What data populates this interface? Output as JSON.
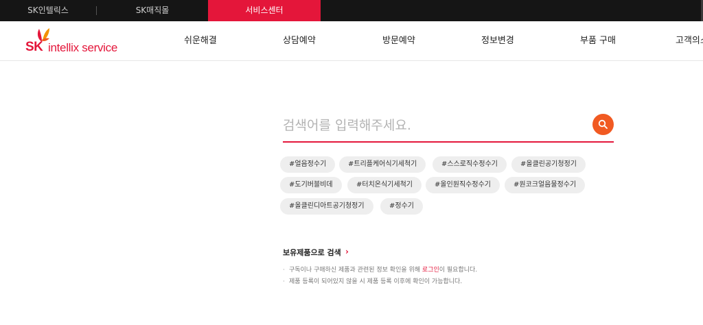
{
  "topbar": {
    "links": [
      "SK인텔릭스",
      "SK매직몰",
      "서비스센터"
    ]
  },
  "header": {
    "logo_sk": "SK",
    "logo_rest": "intellix service",
    "nav": [
      "쉬운해결",
      "상담예약",
      "방문예약",
      "정보변경",
      "부품 구매",
      "고객의소"
    ]
  },
  "search": {
    "placeholder": "검색어를 입력해주세요.",
    "value": ""
  },
  "tags": [
    [
      "#얼음정수기",
      "#트리플케어식기세척기",
      "#스스로직수정수기",
      "#올클린공기청정기"
    ],
    [
      "#도기버블비데",
      "#터치온식기세척기",
      "#올인원직수정수기",
      "#원코크얼음물정수기"
    ],
    [
      "#올클린디아트공기청정기",
      "#정수기"
    ]
  ],
  "owned": {
    "title": "보유제품으로 검색",
    "chevron": "›",
    "note1_before": "구독이나 구매하신 제품과 관련된 정보 확인을 위해 ",
    "note1_link": "로그인",
    "note1_after": "이 필요합니다.",
    "note2": "제품 등록이 되어있지 않을 시 제품 등록 이후에 확인이 가능합니다.",
    "bullet": "·"
  },
  "colors": {
    "accent_red": "#e4163a",
    "search_orange": "#f15a22",
    "topbar_bg": "#151515",
    "tag_bg": "#eeeeee"
  },
  "icons": {
    "search_button": "search-icon",
    "logo_mark": "sk-butterfly-logo-icon"
  }
}
